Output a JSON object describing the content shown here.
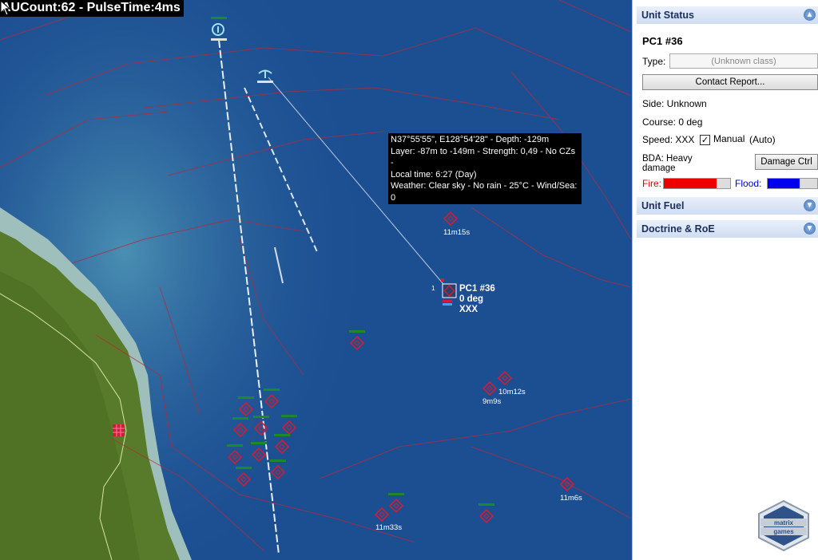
{
  "hud": {
    "text": "AUCount:62 - PulseTime:4ms"
  },
  "tooltip": {
    "lines": [
      "N37°55'55\", E128°54'28\" - Depth: -129m",
      "Layer: -87m to -149m - Strength: 0,49 - No CZs -",
      "Local time: 6:27 (Day)",
      "Weather: Clear sky - No rain - 25°C - Wind/Sea: 0"
    ]
  },
  "selected_unit": {
    "index": "1",
    "name": "PC1 #36",
    "course": "0 deg",
    "speed": "XXX"
  },
  "contact_labels": [
    "11m15s",
    "10m12s",
    "9m9s",
    "11m6s",
    "11m33s"
  ],
  "panel": {
    "unit_status": {
      "header": "Unit Status",
      "unit_name": "PC1 #36",
      "type_label": "Type:",
      "type_value": "(Unknown class)",
      "contact_report_button": "Contact Report...",
      "side": "Side: Unknown",
      "course": "Course: 0 deg",
      "speed": "Speed: XXX",
      "manual_label": "Manual",
      "manual_checked": true,
      "auto_label": "(Auto)",
      "bda": "BDA: Heavy damage",
      "damage_button": "Damage Ctrl",
      "fire_label": "Fire:",
      "fire_level": 0.8,
      "flood_label": "Flood:",
      "flood_level": 0.65
    },
    "unit_fuel": {
      "header": "Unit Fuel"
    },
    "doctrine": {
      "header": "Doctrine & RoE"
    }
  },
  "logo": {
    "text_top": "matrix",
    "text_bottom": "games"
  },
  "colors": {
    "ocean": "#1c4f92",
    "land": "#577b2a",
    "contact": "#cc1e34",
    "fire_bar": "#ee0000",
    "flood_bar": "#0000ee",
    "header_text": "#1b2f5a"
  }
}
